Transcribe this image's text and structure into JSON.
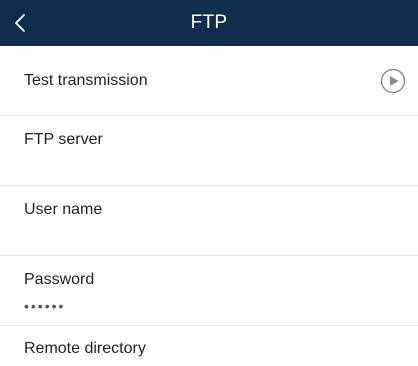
{
  "header": {
    "title": "FTP",
    "back_icon": "chevron-left-icon"
  },
  "test_transmission": {
    "label": "Test transmission",
    "icon": "play-circle-icon"
  },
  "fields": {
    "ftp_server": {
      "label": "FTP server",
      "value": ""
    },
    "user_name": {
      "label": "User name",
      "value": ""
    },
    "password": {
      "label": "Password",
      "value": "••••••"
    },
    "remote_directory": {
      "label": "Remote directory",
      "value": ""
    }
  },
  "colors": {
    "header_background": "#112d4e",
    "header_text": "#ffffff",
    "divider": "#e7e7e7",
    "icon_gray": "#8c8c8c"
  }
}
